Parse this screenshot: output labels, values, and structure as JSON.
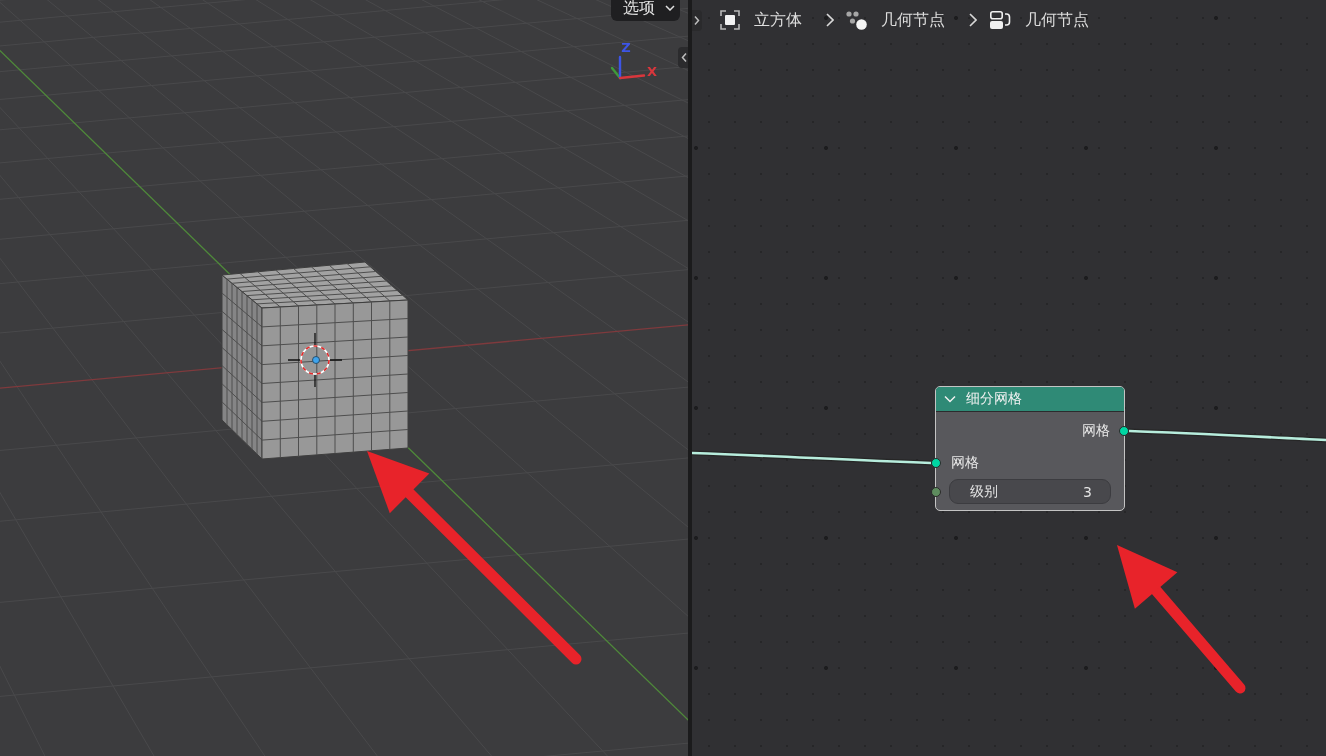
{
  "viewport": {
    "view_menu": {
      "label": "选项"
    },
    "gizmo": {
      "axes": [
        {
          "label": "Z",
          "color": "#3d55e6"
        },
        {
          "label": "X",
          "color": "#d9363c"
        }
      ]
    }
  },
  "node_editor": {
    "breadcrumbs": [
      {
        "label": "立方体",
        "kind": "object"
      },
      {
        "label": "几何节点",
        "kind": "modifier"
      },
      {
        "label": "几何节点",
        "kind": "node_group"
      }
    ],
    "node": {
      "title": "细分网格",
      "expanded": true,
      "outputs": [
        {
          "label": "网格",
          "color": "#00d6a3"
        }
      ],
      "inputs": [
        {
          "label": "网格",
          "kind": "socket",
          "color": "#00d6a3"
        },
        {
          "label": "级别",
          "kind": "field",
          "value": "3",
          "color": "#5e8c5e"
        }
      ]
    }
  }
}
